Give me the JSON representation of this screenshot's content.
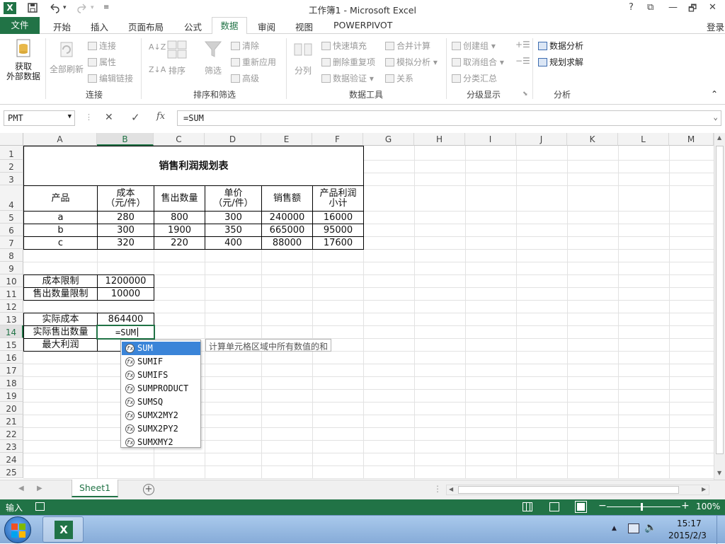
{
  "window": {
    "title": "工作簿1 - Microsoft Excel",
    "help": "?",
    "restore": "⧉",
    "minimize": "—",
    "maximize": "🗗",
    "close": "✕",
    "app_icon": "X"
  },
  "tabs": {
    "file": "文件",
    "items": [
      "开始",
      "插入",
      "页面布局",
      "公式",
      "数据",
      "审阅",
      "视图",
      "POWERPIVOT"
    ],
    "active": "数据",
    "login": "登录"
  },
  "ribbon": {
    "get_external_data_1": "获取",
    "get_external_data_2": "外部数据",
    "refresh_all": "全部刷新",
    "connections": "连接",
    "properties": "属性",
    "edit_links": "编辑链接",
    "group_connections": "连接",
    "sort": "排序",
    "filter": "筛选",
    "clear": "清除",
    "reapply": "重新应用",
    "advanced": "高级",
    "group_sort_filter": "排序和筛选",
    "text_to_columns": "分列",
    "flash_fill": "快速填充",
    "remove_duplicates": "删除重复项",
    "data_validation": "数据验证",
    "consolidate": "合并计算",
    "what_if": "模拟分析",
    "relationships": "关系",
    "group_data_tools": "数据工具",
    "group": "创建组",
    "ungroup": "取消组合",
    "subtotal": "分类汇总",
    "group_outline": "分级显示",
    "data_analysis": "数据分析",
    "solver": "规划求解",
    "group_analysis": "分析"
  },
  "formula_bar": {
    "name_box": "PMT",
    "cancel": "✕",
    "enter": "✓",
    "fx": "fx",
    "formula": "=SUM"
  },
  "columns": [
    "A",
    "B",
    "C",
    "D",
    "E",
    "F",
    "G",
    "H",
    "I",
    "J",
    "K",
    "L",
    "M"
  ],
  "rows": [
    "1",
    "2",
    "3",
    "4",
    "5",
    "6",
    "7",
    "8",
    "9",
    "10",
    "11",
    "12",
    "13",
    "14",
    "15",
    "16",
    "17",
    "18",
    "19",
    "20",
    "21",
    "22",
    "23",
    "24",
    "25"
  ],
  "sheet": {
    "title": "销售利润规划表",
    "headers": [
      "产品",
      "成本\n（元/件）",
      "售出数量",
      "单价\n（元/件）",
      "销售额",
      "产品利润\n小计"
    ],
    "data": [
      [
        "a",
        "280",
        "800",
        "300",
        "240000",
        "16000"
      ],
      [
        "b",
        "300",
        "1900",
        "350",
        "665000",
        "95000"
      ],
      [
        "c",
        "320",
        "220",
        "400",
        "88000",
        "17600"
      ]
    ],
    "cost_limit_label": "成本限制",
    "cost_limit_value": "1200000",
    "qty_limit_label": "售出数量限制",
    "qty_limit_value": "10000",
    "actual_cost_label": "实际成本",
    "actual_cost_value": "864400",
    "actual_qty_label": "实际售出数量",
    "actual_qty_value": "=SUM",
    "max_profit_label": "最大利润"
  },
  "autocomplete": {
    "items": [
      "SUM",
      "SUMIF",
      "SUMIFS",
      "SUMPRODUCT",
      "SUMSQ",
      "SUMX2MY2",
      "SUMX2PY2",
      "SUMXMY2"
    ],
    "tooltip": "计算单元格区域中所有数值的和"
  },
  "sheet_tabs": {
    "active": "Sheet1",
    "add": "+"
  },
  "status_bar": {
    "mode": "输入",
    "zoom": "100%"
  },
  "taskbar": {
    "time": "15:17",
    "date": "2015/2/3"
  }
}
